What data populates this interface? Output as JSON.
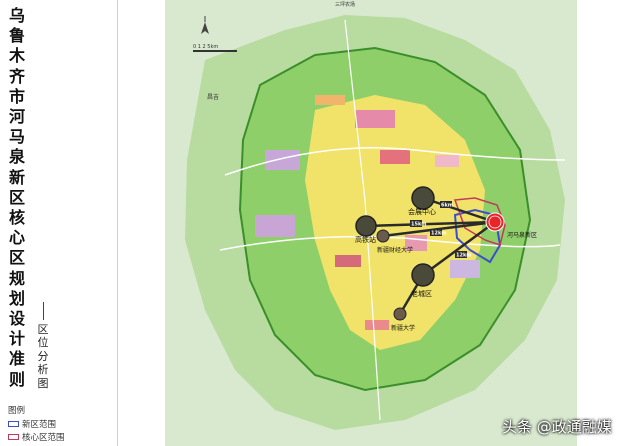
{
  "sidebar": {
    "title": "乌鲁木齐市河马泉新区核心区规划设计准则",
    "subtitle": "区位分析图",
    "legend": {
      "heading": "图例",
      "items": [
        {
          "label": "新区范围",
          "color": "#3b4fc8"
        },
        {
          "label": "核心区范围",
          "color": "#c23a5a"
        }
      ]
    }
  },
  "map": {
    "place_labels": {
      "changji": "昌吉",
      "top_road": "三坪农场"
    },
    "scale_text": "0  1  2        5km",
    "nodes": [
      {
        "id": "convention",
        "label": "会展中心"
      },
      {
        "id": "hightech",
        "label": "高铁站"
      },
      {
        "id": "xinjiang_finance",
        "label": "新疆财经大学"
      },
      {
        "id": "old_city",
        "label": "老城区"
      },
      {
        "id": "xinjiang_univ",
        "label": "新疆大学"
      },
      {
        "id": "hemaquan",
        "label": "河马泉新区"
      }
    ],
    "distances": {
      "to_convention": "6km",
      "to_hightech": "15km",
      "to_finance": "12km",
      "to_old_city": "12km"
    }
  },
  "watermark": "头条 @政通融媒",
  "colors": {
    "new_district_boundary": "#3b4fc8",
    "core_boundary": "#c23a5a",
    "target_node": "#e8262a"
  }
}
